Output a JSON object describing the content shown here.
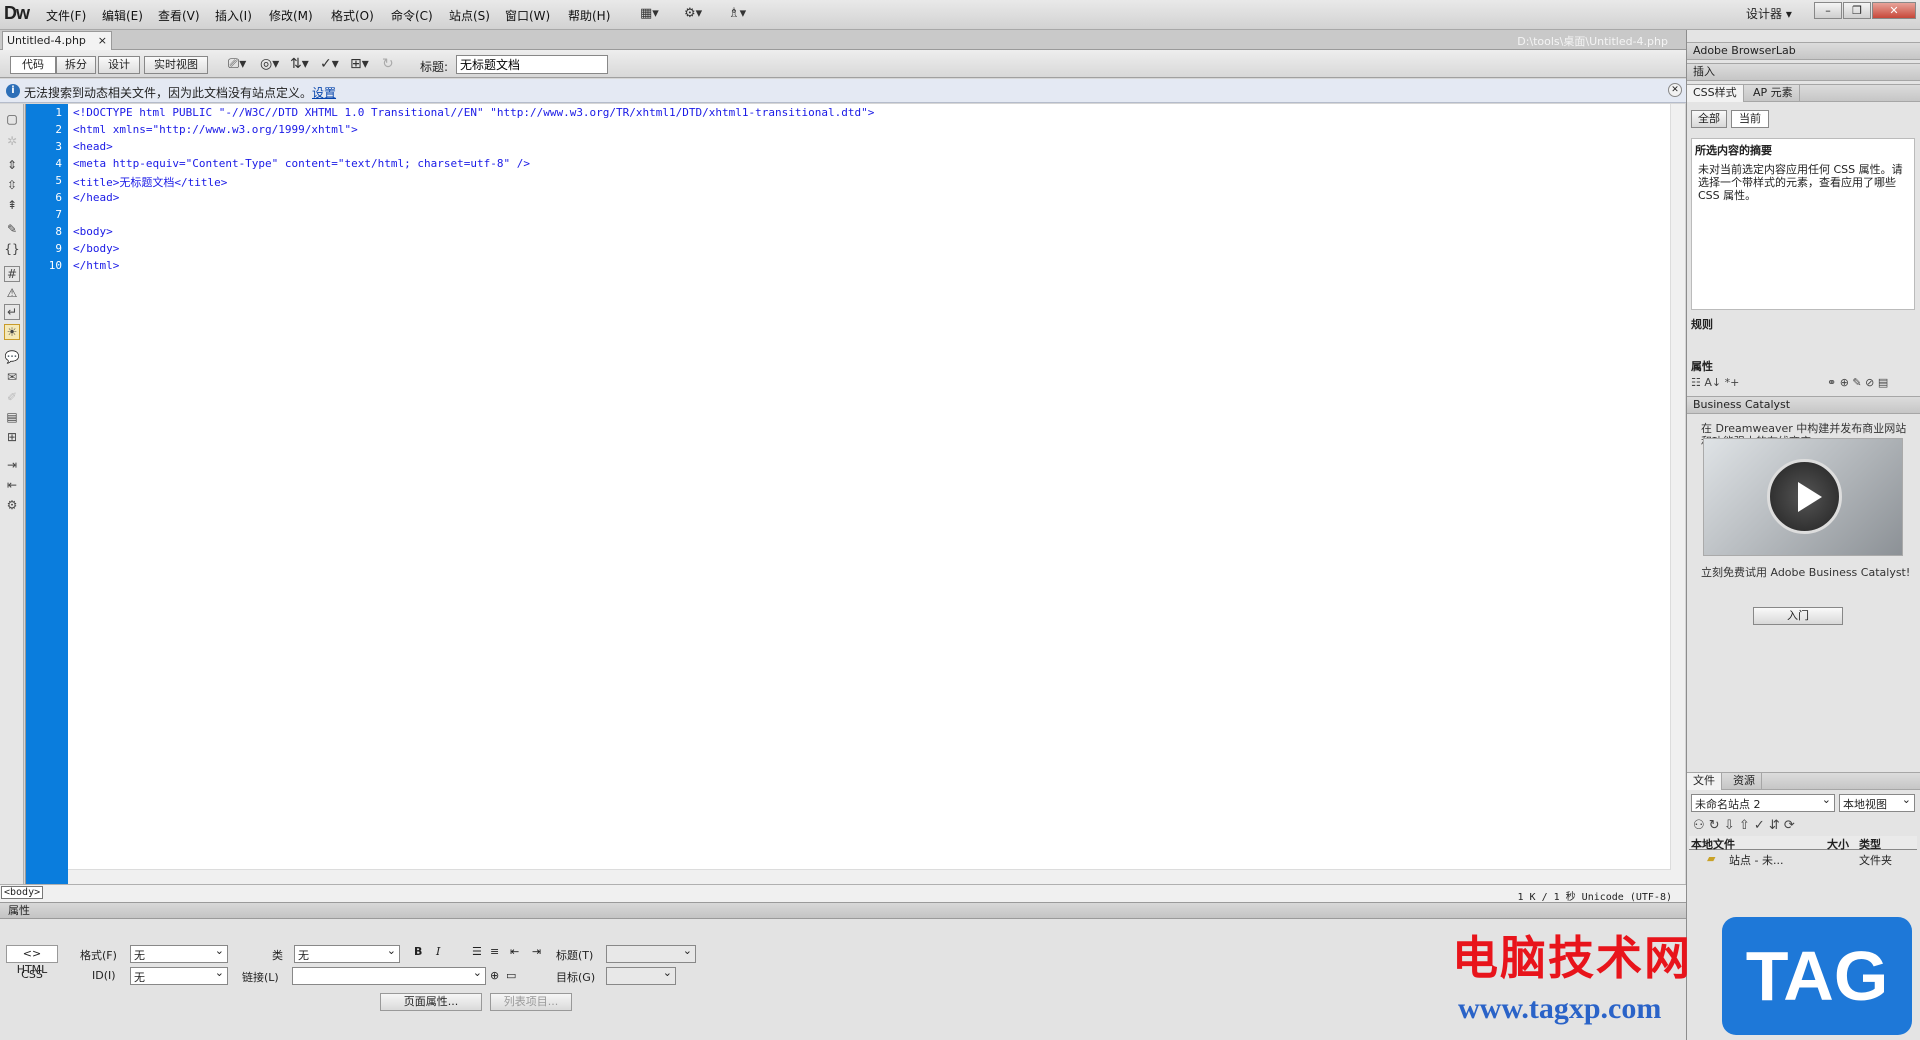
{
  "app": {
    "logo": "Dw"
  },
  "menu": [
    "文件(F)",
    "编辑(E)",
    "查看(V)",
    "插入(I)",
    "修改(M)",
    "格式(O)",
    "命令(C)",
    "站点(S)",
    "窗口(W)",
    "帮助(H)"
  ],
  "menu_icons": [
    "layout-icon",
    "gear-icon",
    "sitemap-icon"
  ],
  "workspace": {
    "label": "设计器 ▾"
  },
  "window_buttons": [
    "–",
    "❐",
    "✕"
  ],
  "document_tab": {
    "name": "Untitled-4.php",
    "close": "×",
    "path": "D:\\tools\\桌面\\Untitled-4.php"
  },
  "view_buttons": {
    "code": "代码",
    "split": "拆分",
    "design": "设计",
    "live": "实时视图"
  },
  "title_field": {
    "label": "标题:",
    "value": "无标题文档"
  },
  "info_bar": {
    "message": "无法搜索到动态相关文件，因为此文档没有站点定义。",
    "link": "设置",
    "icon": "i"
  },
  "code_lines": [
    {
      "num": "1",
      "text": "<!DOCTYPE html PUBLIC \"-//W3C//DTD XHTML 1.0 Transitional//EN\" \"http://www.w3.org/TR/xhtml1/DTD/xhtml1-transitional.dtd\">"
    },
    {
      "num": "2",
      "text": "<html xmlns=\"http://www.w3.org/1999/xhtml\">"
    },
    {
      "num": "3",
      "text": "<head>"
    },
    {
      "num": "4",
      "text": "<meta http-equiv=\"Content-Type\" content=\"text/html; charset=utf-8\" />"
    },
    {
      "num": "5",
      "text": "<title>无标题文档</title>"
    },
    {
      "num": "6",
      "text": "</head>"
    },
    {
      "num": "7",
      "text": ""
    },
    {
      "num": "8",
      "text": "<body>"
    },
    {
      "num": "9",
      "text": "</body>"
    },
    {
      "num": "10",
      "text": "</html>"
    }
  ],
  "status": {
    "tag": "<body>",
    "info": "1 K / 1 秒  Unicode (UTF-8)"
  },
  "properties": {
    "header": "属性",
    "html_btn": "<> HTML",
    "css_btn": "CSS",
    "format_label": "格式(F)",
    "format_value": "无",
    "id_label": "ID(I)",
    "id_value": "无",
    "class_label": "类",
    "class_value": "无",
    "link_label": "链接(L)",
    "link_value": "",
    "title_label": "标题(T)",
    "target_label": "目标(G)",
    "bold": "B",
    "italic": "I",
    "page_props": "页面属性...",
    "list_item": "列表项目..."
  },
  "right_panel": {
    "browserlab": "Adobe BrowserLab",
    "insert": "插入",
    "css_tab": "CSS样式",
    "ap_tab": "AP 元素",
    "all_btn": "全部",
    "current_btn": "当前",
    "summary_title": "所选内容的摘要",
    "summary_text": "未对当前选定内容应用任何 CSS 属性。请选择一个带样式的元素，查看应用了哪些 CSS 属性。",
    "rules_title": "规则",
    "props_title": "属性",
    "bc_header": "Business Catalyst",
    "bc_intro": "在 Dreamweaver 中构建并发布商业网站和功能强大的在线商店。",
    "bc_try": "立刻免费试用 Adobe Business Catalyst!",
    "bc_button": "入门",
    "files_tab": "文件",
    "assets_tab": "资源",
    "site_select": "未命名站点 2",
    "view_select": "本地视图",
    "col_local": "本地文件",
    "col_size": "大小",
    "col_type": "类型",
    "row_name": "站点 - 未...",
    "row_type": "文件夹"
  },
  "watermark": {
    "text": "电脑技术网",
    "url": "www.tagxp.com",
    "tag": "TAG"
  }
}
